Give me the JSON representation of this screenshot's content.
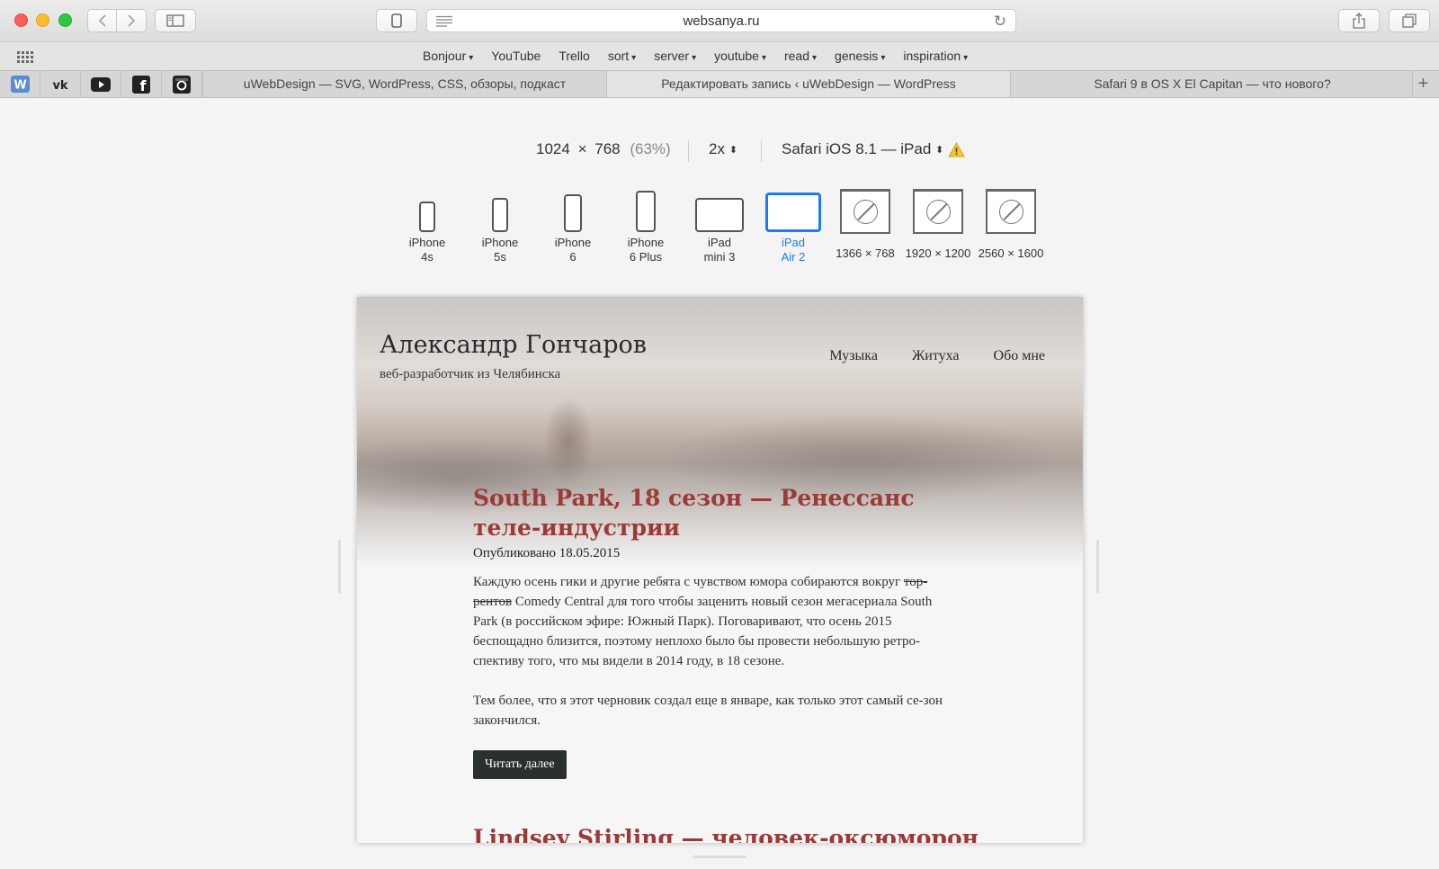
{
  "browser": {
    "url": "websanya.ru",
    "favorites": [
      {
        "label": "Bonjour",
        "menu": true
      },
      {
        "label": "YouTube",
        "menu": false
      },
      {
        "label": "Trello",
        "menu": false
      },
      {
        "label": "sort",
        "menu": true
      },
      {
        "label": "server",
        "menu": true
      },
      {
        "label": "youtube",
        "menu": true
      },
      {
        "label": "read",
        "menu": true
      },
      {
        "label": "genesis",
        "menu": true
      },
      {
        "label": "inspiration",
        "menu": true
      }
    ],
    "pinned_tabs": [
      "W",
      "VK",
      "YouTube",
      "Facebook",
      "Instagram"
    ],
    "tabs": [
      "uWebDesign — SVG, WordPress, CSS, обзоры, подкаст",
      "Редактировать запись ‹ uWebDesign — WordPress",
      "Safari 9 в OS X El Capitan — что нового?"
    ]
  },
  "responsive": {
    "width": "1024",
    "times": "×",
    "height": "768",
    "percent": "(63%)",
    "scale": "2x",
    "user_agent": "Safari iOS 8.1 — iPad",
    "devices": [
      {
        "line1": "iPhone",
        "line2": "4s",
        "active": false
      },
      {
        "line1": "iPhone",
        "line2": "5s",
        "active": false
      },
      {
        "line1": "iPhone",
        "line2": "6",
        "active": false
      },
      {
        "line1": "iPhone",
        "line2": "6 Plus",
        "active": false
      },
      {
        "line1": "iPad",
        "line2": "mini 3",
        "active": false
      },
      {
        "line1": "iPad",
        "line2": "Air 2",
        "active": true
      },
      {
        "line1": "1366 × 768",
        "line2": "",
        "active": false
      },
      {
        "line1": "1920 × 1200",
        "line2": "",
        "active": false
      },
      {
        "line1": "2560 × 1600",
        "line2": "",
        "active": false
      }
    ]
  },
  "site": {
    "title": "Александр Гончаров",
    "tagline": "веб-разработчик из Челябинска",
    "nav": [
      "Музыка",
      "Житуха",
      "Обо мне"
    ],
    "post": {
      "title": "South Park, 18 сезон — Ренессанс теле-индустрии",
      "date": "Опубликовано 18.05.2015",
      "p1_before": "Каждую осень гики и другие ребята с чувством юмора собираются вокруг ",
      "p1_strike": "тор-рентов",
      "p1_after": " Comedy Central для того чтобы заценить новый сезон мегасериала South Park (в российском эфире: Южный Парк). Поговаривают, что осень 2015 беспощадно близится, поэтому неплохо было бы провести небольшую ретро-спективу того, что мы видели в 2014 году, в 18 сезоне.",
      "p2": "Тем более, что я этот черновик создал еще в январе, как только этот самый се-зон закончился.",
      "read_more": "Читать далее"
    },
    "next_title": "Lindsey Stirling — человек-оксюморон"
  },
  "colors": {
    "accent": "#1d7cf2",
    "post_title": "#9b3a36",
    "button_bg": "#2a2f30"
  }
}
